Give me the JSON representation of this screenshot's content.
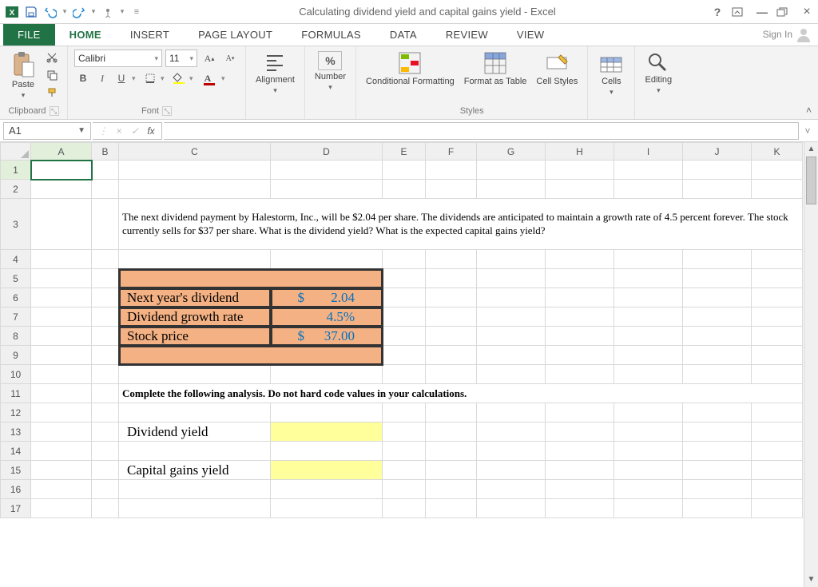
{
  "app": {
    "title": "Calculating dividend yield and capital gains yield - Excel",
    "signin": "Sign In"
  },
  "tabs": {
    "file": "FILE",
    "home": "HOME",
    "insert": "INSERT",
    "page_layout": "PAGE LAYOUT",
    "formulas": "FORMULAS",
    "data": "DATA",
    "review": "REVIEW",
    "view": "VIEW"
  },
  "ribbon": {
    "clipboard": {
      "label": "Clipboard",
      "paste": "Paste"
    },
    "font": {
      "label": "Font",
      "name": "Calibri",
      "size": "11"
    },
    "alignment": {
      "label": "Alignment"
    },
    "number": {
      "label": "Number",
      "percent": "%"
    },
    "styles": {
      "label": "Styles",
      "cond": "Conditional Formatting",
      "table": "Format as Table",
      "cell": "Cell Styles"
    },
    "cells": {
      "label": "Cells"
    },
    "editing": {
      "label": "Editing"
    }
  },
  "namebox": {
    "ref": "A1"
  },
  "columns": [
    "A",
    "B",
    "C",
    "D",
    "E",
    "F",
    "G",
    "H",
    "I",
    "J",
    "K"
  ],
  "rows": [
    "1",
    "2",
    "3",
    "4",
    "5",
    "6",
    "7",
    "8",
    "9",
    "10",
    "11",
    "12",
    "13",
    "14",
    "15",
    "16",
    "17"
  ],
  "sheet": {
    "question": "The next dividend payment by Halestorm, Inc., will be $2.04 per share. The dividends are anticipated to maintain a growth rate of 4.5 percent forever. The stock currently sells for $37 per share. What is the dividend yield? What is the expected capital gains yield?",
    "labels": {
      "next_div": "Next year's dividend",
      "growth": "Dividend growth rate",
      "price": "Stock price",
      "div_yield": "Dividend yield",
      "cap_gains": "Capital gains yield"
    },
    "currency": "$",
    "values": {
      "next_div": "2.04",
      "growth": "4.5%",
      "price": "37.00"
    },
    "instruction": "Complete the following analysis. Do not hard code values in your calculations."
  }
}
